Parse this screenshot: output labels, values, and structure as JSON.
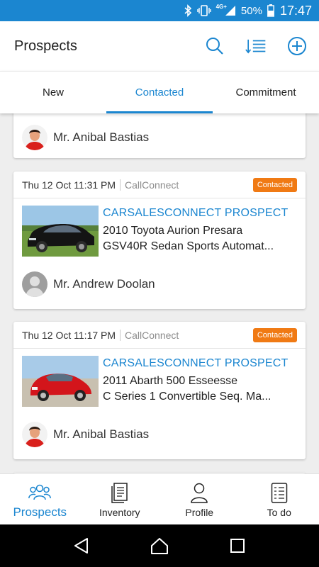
{
  "status_bar": {
    "network": "4G+",
    "battery": "50%",
    "time": "17:47",
    "icons": [
      "bluetooth-icon",
      "vibrate-icon",
      "signal-icon",
      "battery-icon"
    ]
  },
  "header": {
    "title": "Prospects",
    "icons": [
      "search-icon",
      "sort-icon",
      "add-icon"
    ]
  },
  "tabs": [
    {
      "label": "New",
      "active": false
    },
    {
      "label": "Contacted",
      "active": true
    },
    {
      "label": "Commitment",
      "active": false
    }
  ],
  "cards": [
    {
      "person": "Mr. Anibal Bastias",
      "avatar": "photo"
    },
    {
      "date": "Thu 12 Oct 11:31 PM",
      "source": "CallConnect",
      "badge": "Contacted",
      "heading": "CARSALESCONNECT PROSPECT",
      "car_line1": "2010 Toyota Aurion Presara",
      "car_line2": "GSV40R Sedan Sports Automat...",
      "person": "Mr. Andrew Doolan",
      "avatar": "placeholder"
    },
    {
      "date": "Thu 12 Oct 11:17 PM",
      "source": "CallConnect",
      "badge": "Contacted",
      "heading": "CARSALESCONNECT PROSPECT",
      "car_line1": "2011 Abarth 500 Esseesse",
      "car_line2": "C Series 1 Convertible Seq. Ma...",
      "person": "Mr. Anibal Bastias",
      "avatar": "photo"
    }
  ],
  "bottom_nav": [
    {
      "label": "Prospects",
      "icon": "people-icon",
      "active": true
    },
    {
      "label": "Inventory",
      "icon": "document-icon",
      "active": false
    },
    {
      "label": "Profile",
      "icon": "person-icon",
      "active": false
    },
    {
      "label": "To do",
      "icon": "checklist-icon",
      "active": false
    }
  ],
  "colors": {
    "accent": "#1b86d0",
    "badge": "#f07a14",
    "status_bar": "#1b86d0",
    "background": "#eeeeee"
  }
}
